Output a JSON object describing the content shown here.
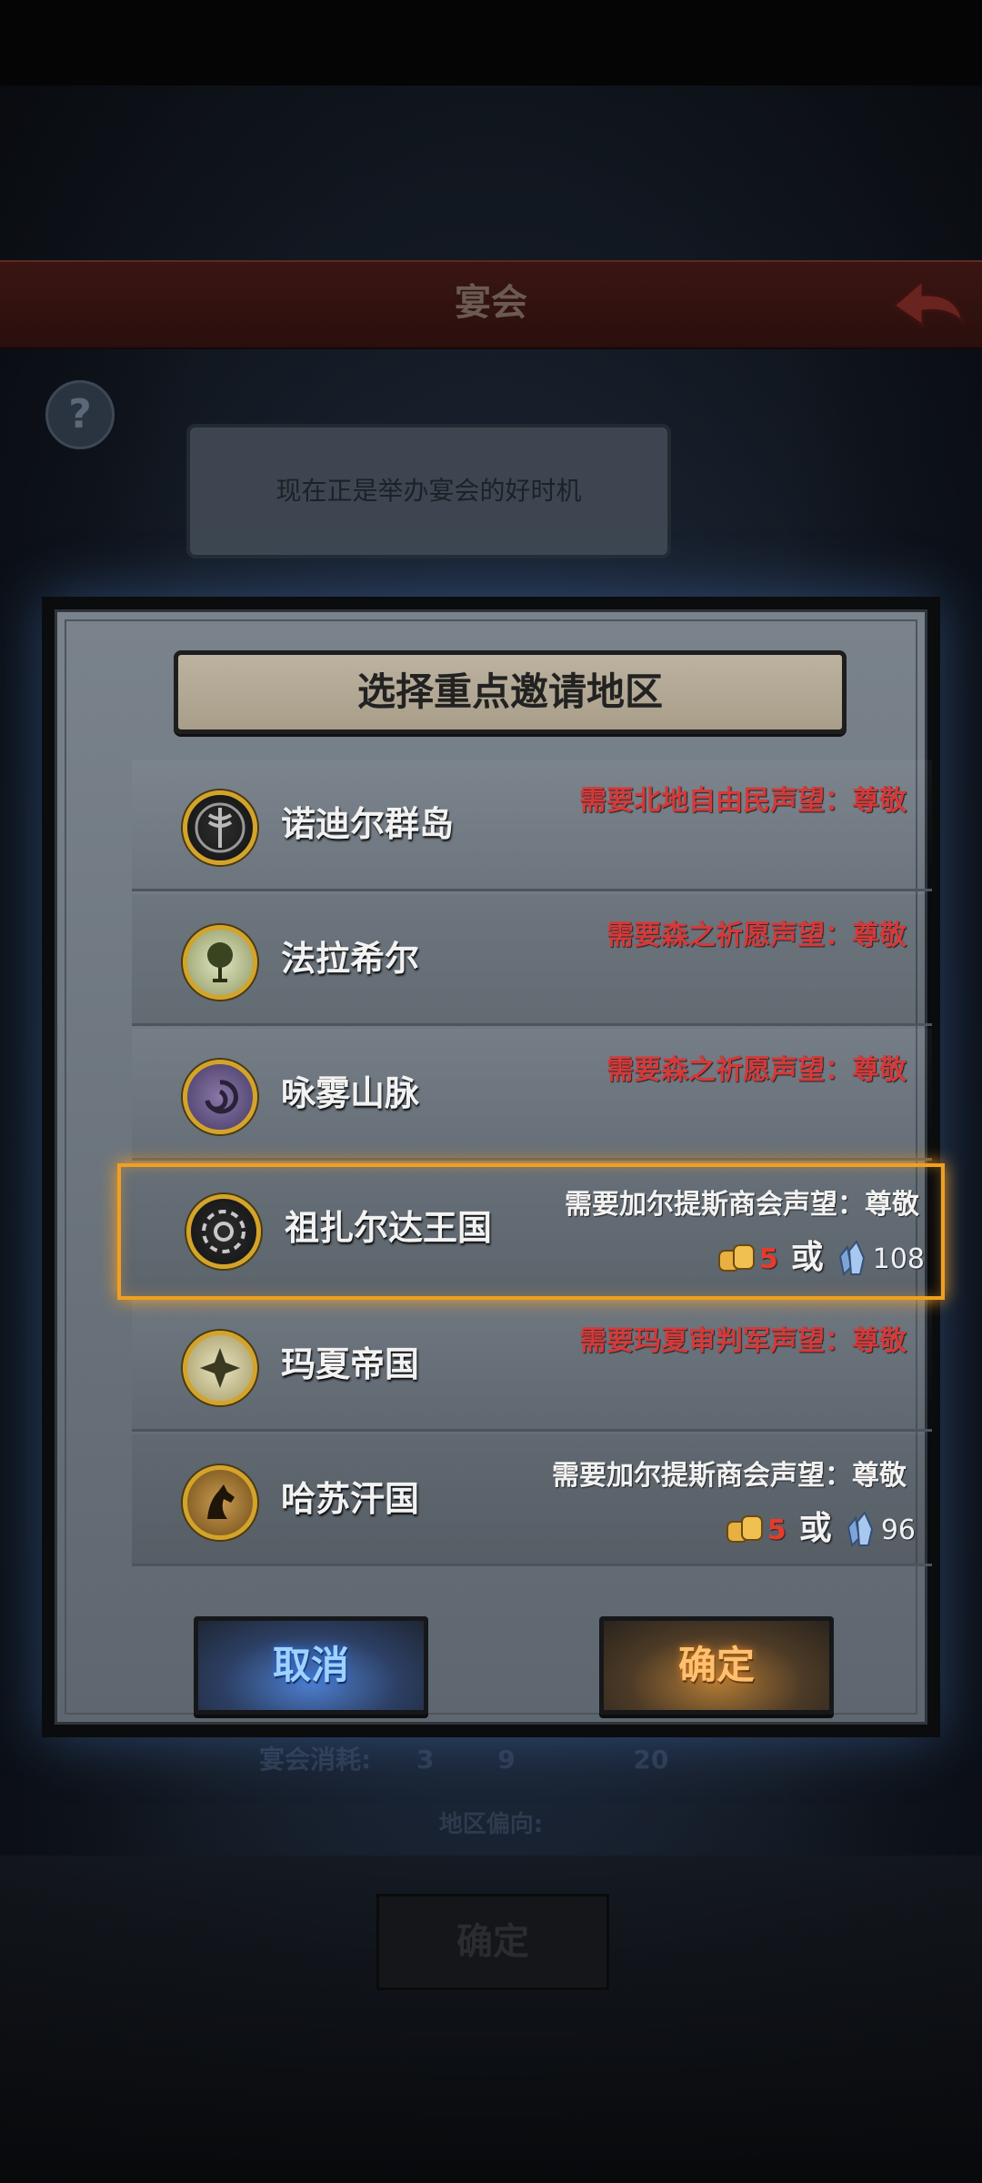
{
  "background": {
    "header_title": "宴会",
    "speech": "现在正是举办宴会的好时机",
    "cost_label": "宴会消耗:",
    "cost_values": [
      "3",
      "9",
      "20"
    ],
    "region_label": "地区偏向:",
    "confirm_label": "确定"
  },
  "modal": {
    "title": "选择重点邀请地区",
    "regions": [
      {
        "name": "诺迪尔群岛",
        "requirement": "需要北地自由民声望：尊敬",
        "met": false,
        "emblem": "axe-emblem-icon"
      },
      {
        "name": "法拉希尔",
        "requirement": "需要森之祈愿声望：尊敬",
        "met": false,
        "emblem": "tree-emblem-icon"
      },
      {
        "name": "咏雾山脉",
        "requirement": "需要森之祈愿声望：尊敬",
        "met": false,
        "emblem": "swirl-emblem-icon"
      },
      {
        "name": "祖扎尔达王国",
        "requirement": "需要加尔提斯商会声望：尊敬",
        "met": true,
        "selected": true,
        "emblem": "wheel-emblem-icon",
        "cost_bread": "5",
        "or_label": "或",
        "cost_crystal": "108"
      },
      {
        "name": "玛夏帝国",
        "requirement": "需要玛夏审判军声望：尊敬",
        "met": false,
        "emblem": "cross-emblem-icon"
      },
      {
        "name": "哈苏汗国",
        "requirement": "需要加尔提斯商会声望：尊敬",
        "met": true,
        "emblem": "horse-emblem-icon",
        "cost_bread": "5",
        "or_label": "或",
        "cost_crystal": "96"
      }
    ],
    "cancel_label": "取消",
    "confirm_label": "确定"
  },
  "colors": {
    "requirement_unmet": "#d33a3a",
    "selection_glow": "#f0a020",
    "cancel_button": "#4d7fd0",
    "confirm_button": "#b07a35"
  }
}
